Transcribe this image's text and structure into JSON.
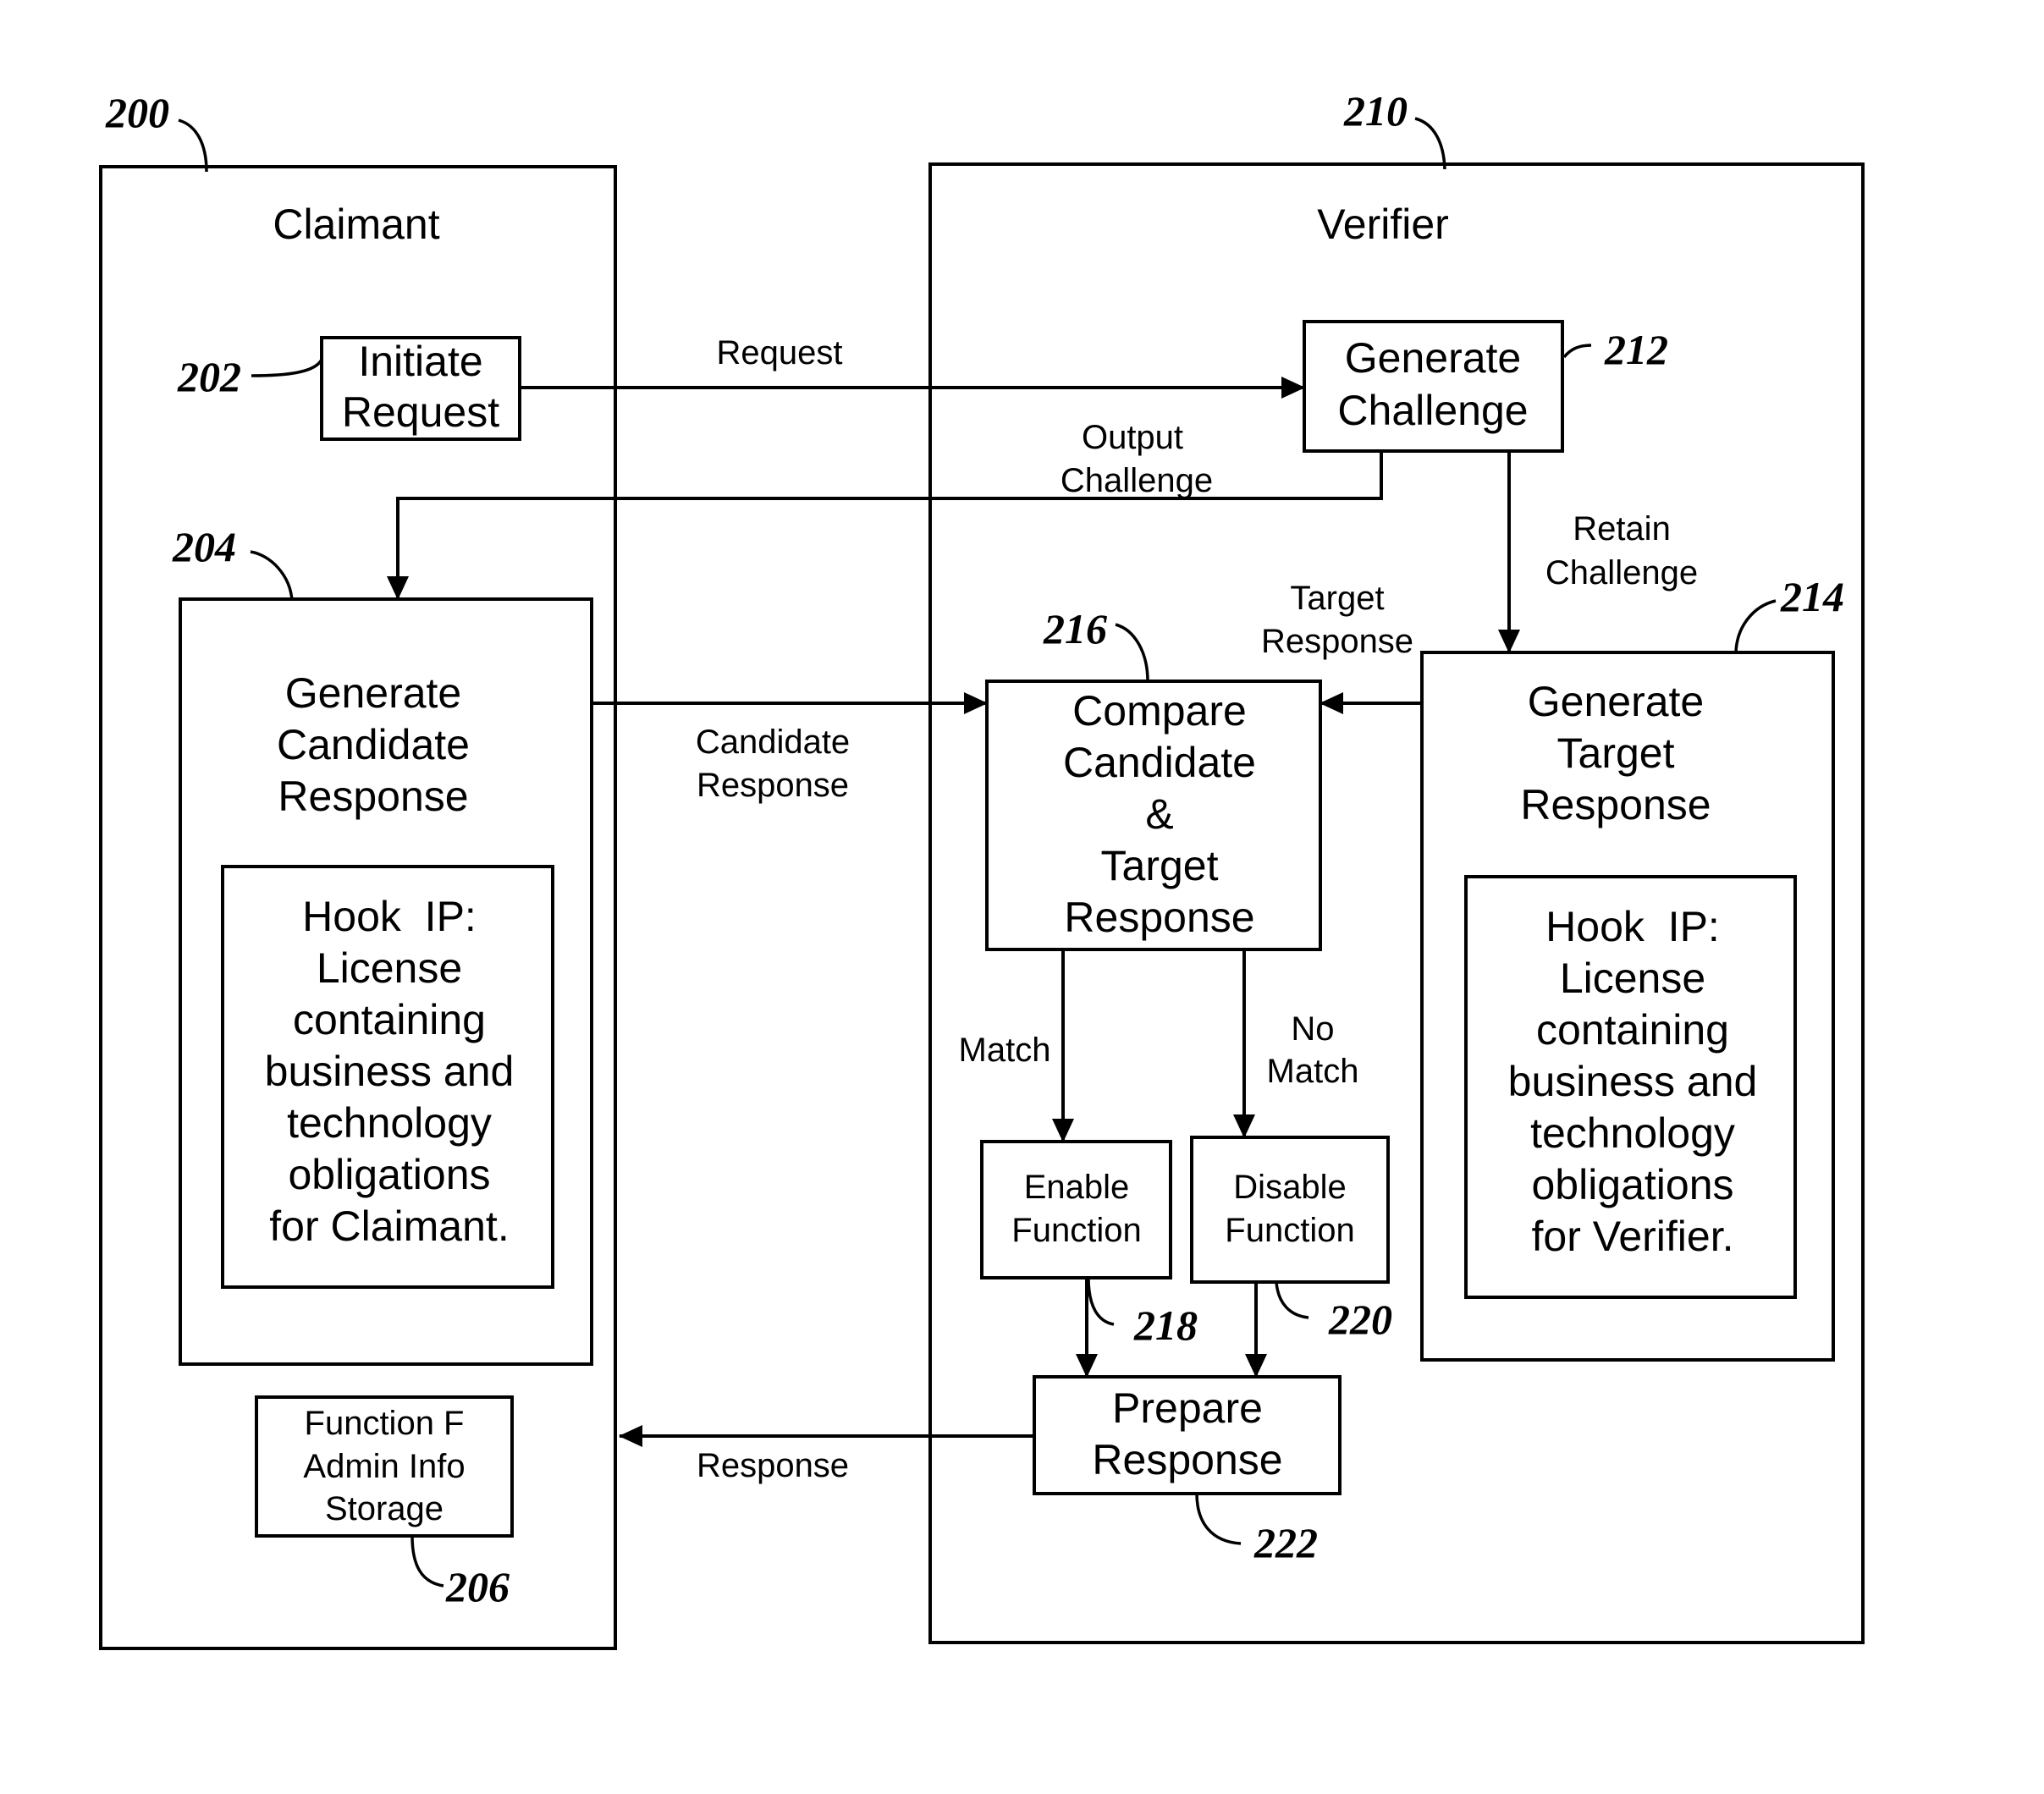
{
  "figure": {
    "claimant": {
      "ref": "200",
      "title": "Claimant"
    },
    "verifier": {
      "ref": "210",
      "title": "Verifier"
    },
    "nodes": {
      "initiate_request": {
        "ref": "202",
        "lines": [
          "Initiate",
          "Request"
        ]
      },
      "generate_candidate": {
        "ref": "204",
        "lines": [
          "Generate",
          "Candidate",
          "Response"
        ]
      },
      "hook_claimant": {
        "lines": [
          "Hook  IP:",
          "License",
          "containing",
          "business and",
          "technology",
          "obligations",
          "for Claimant."
        ]
      },
      "function_f": {
        "ref": "206",
        "lines": [
          "Function F",
          "Admin Info",
          "Storage"
        ]
      },
      "generate_challenge": {
        "ref": "212",
        "lines": [
          "Generate",
          "Challenge"
        ]
      },
      "generate_target": {
        "ref": "214",
        "lines": [
          "Generate",
          "Target",
          "Response"
        ]
      },
      "hook_verifier": {
        "lines": [
          "Hook  IP:",
          "License",
          "containing",
          "business and",
          "technology",
          "obligations",
          "for Verifier."
        ]
      },
      "compare": {
        "ref": "216",
        "lines": [
          "Compare",
          "Candidate",
          "&",
          "Target",
          "Response"
        ]
      },
      "enable_function": {
        "ref": "218",
        "lines": [
          "Enable",
          "Function"
        ]
      },
      "disable_function": {
        "ref": "220",
        "lines": [
          "Disable",
          "Function"
        ]
      },
      "prepare_response": {
        "ref": "222",
        "lines": [
          "Prepare",
          "Response"
        ]
      }
    },
    "edges": {
      "request": [
        "Request"
      ],
      "output_challenge": [
        "Output",
        "Challenge"
      ],
      "retain_challenge": [
        "Retain",
        "Challenge"
      ],
      "target_response": [
        "Target",
        "Response"
      ],
      "candidate_response": [
        "Candidate",
        "Response"
      ],
      "match": [
        "Match"
      ],
      "no_match": [
        "No",
        "Match"
      ],
      "response": [
        "Response"
      ]
    }
  }
}
